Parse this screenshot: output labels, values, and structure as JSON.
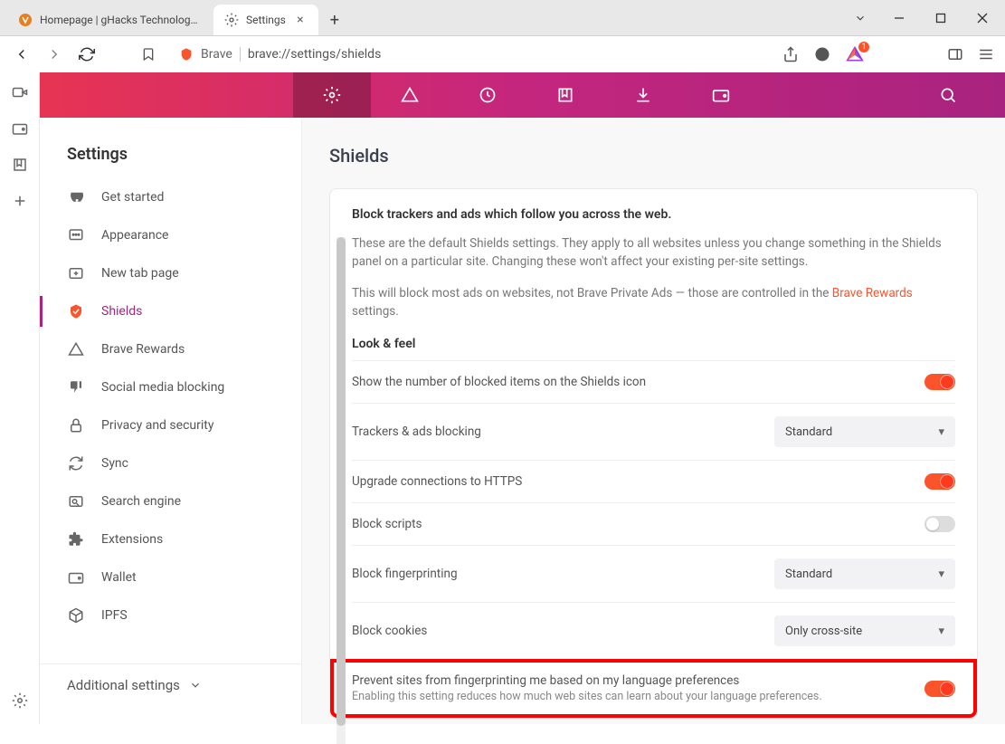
{
  "window": {
    "tabs": [
      {
        "title": "Homepage | gHacks Technology News",
        "active": false
      },
      {
        "title": "Settings",
        "active": true
      }
    ]
  },
  "urlbar": {
    "brave_label": "Brave",
    "url": "brave://settings/shields",
    "bat_badge": "1"
  },
  "sidebar": {
    "title": "Settings",
    "items": [
      {
        "icon": "rocket",
        "label": "Get started"
      },
      {
        "icon": "appearance",
        "label": "Appearance"
      },
      {
        "icon": "newtab",
        "label": "New tab page"
      },
      {
        "icon": "shield",
        "label": "Shields",
        "active": true
      },
      {
        "icon": "rewards",
        "label": "Brave Rewards"
      },
      {
        "icon": "thumbdown",
        "label": "Social media blocking"
      },
      {
        "icon": "lock",
        "label": "Privacy and security"
      },
      {
        "icon": "sync",
        "label": "Sync"
      },
      {
        "icon": "search",
        "label": "Search engine"
      },
      {
        "icon": "puzzle",
        "label": "Extensions"
      },
      {
        "icon": "wallet",
        "label": "Wallet"
      },
      {
        "icon": "cube",
        "label": "IPFS"
      }
    ],
    "additional": "Additional settings"
  },
  "main": {
    "title": "Shields",
    "card": {
      "heading": "Block trackers and ads which follow you across the web.",
      "p1": "These are the default Shields settings. They apply to all websites unless you change something in the Shields panel on a particular site. Changing these won't affect your existing per-site settings.",
      "p2a": "This will block most ads on websites, not Brave Private Ads — those are controlled in the ",
      "p2_link": "Brave Rewards",
      "p2b": " settings.",
      "section": "Look & feel",
      "rows": {
        "show_count": {
          "label": "Show the number of blocked items on the Shields icon",
          "toggle": true
        },
        "trackers": {
          "label": "Trackers & ads blocking",
          "value": "Standard"
        },
        "https": {
          "label": "Upgrade connections to HTTPS",
          "toggle": true
        },
        "scripts": {
          "label": "Block scripts",
          "toggle": false
        },
        "fingerprint": {
          "label": "Block fingerprinting",
          "value": "Standard"
        },
        "cookies": {
          "label": "Block cookies",
          "value": "Only cross-site"
        },
        "lang": {
          "label": "Prevent sites from fingerprinting me based on my language preferences",
          "sub": "Enabling this setting reduces how much web sites can learn about your language preferences.",
          "toggle": true
        }
      }
    }
  }
}
